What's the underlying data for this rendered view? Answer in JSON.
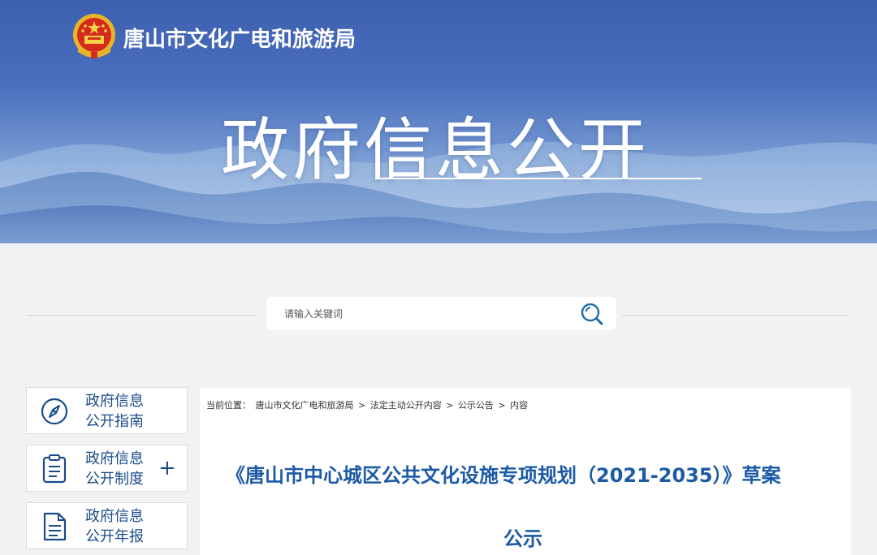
{
  "header": {
    "org_name": "唐山市文化广电和旅游局",
    "hero_title": "政府信息公开",
    "emblem_icon": "national-emblem-icon"
  },
  "search": {
    "placeholder": "请输入关键词",
    "icon": "search-icon"
  },
  "sidebar": {
    "items": [
      {
        "label_line1": "政府信息",
        "label_line2": "公开指南",
        "icon": "compass-icon",
        "expandable": false
      },
      {
        "label_line1": "政府信息",
        "label_line2": "公开制度",
        "icon": "clipboard-icon",
        "expandable": true,
        "toggle": "+"
      },
      {
        "label_line1": "政府信息",
        "label_line2": "公开年报",
        "icon": "document-icon",
        "expandable": false
      }
    ]
  },
  "breadcrumb": {
    "prefix": "当前位置：",
    "items": [
      "唐山市文化广电和旅游局",
      "法定主动公开内容",
      "公示公告",
      "内容"
    ],
    "separator": ">"
  },
  "article": {
    "title_line1": "《唐山市中心城区公共文化设施专项规划（2021-2035）》草案",
    "title_line2": "公示"
  },
  "colors": {
    "banner_blue": "#3d5fb0",
    "nav_text": "#1a4a8a",
    "title_blue": "#1c5aa6",
    "page_bg": "#f1f2f4"
  }
}
